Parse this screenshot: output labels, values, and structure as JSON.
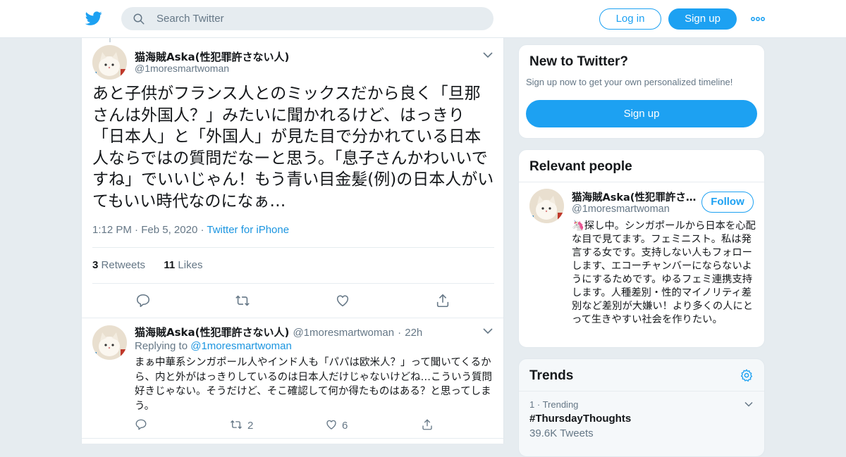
{
  "colors": {
    "brand": "#1da1f2",
    "link": "#1b95e0",
    "muted": "#657786",
    "text": "#14171a",
    "background": "#e6ecf0"
  },
  "header": {
    "logo_icon": "twitter-bird-icon",
    "search": {
      "placeholder": "Search Twitter",
      "icon": "search-icon"
    },
    "login_label": "Log in",
    "signup_label": "Sign up",
    "more_icon": "more-dots-icon"
  },
  "main_tweet": {
    "author_name": "猫海賊Aska(性犯罪許さない人)",
    "author_handle": "@1moresmartwoman",
    "text": "あと子供がフランス人とのミックスだから良く「旦那さんは外国人？」みたいに聞かれるけど、はっきり「日本人」と「外国人」が見た目で分かれている日本人ならではの質問だなーと思う。「息子さんかわいいですね」でいいじゃん！もう青い目金髪(例)の日本人がいてもいい時代なのになぁ…",
    "time": "1:12 PM",
    "date": "Feb 5, 2020",
    "source": "Twitter for iPhone",
    "retweets_count": "3",
    "retweets_label": "Retweets",
    "likes_count": "11",
    "likes_label": "Likes"
  },
  "reply_tweet": {
    "author_name": "猫海賊Aska(性犯罪許さない人)",
    "author_handle": "@1moresmartwoman",
    "age": "22h",
    "replying_label": "Replying to",
    "replying_to": "@1moresmartwoman",
    "text": "まぁ中華系シンガポール人やインド人も「パパは欧米人？」って聞いてくるから、内と外がはっきりしているのは日本人だけじゃないけどね…こういう質問好きじゃない。そうだけど、そこ確認して何か得たものはある？と思ってしまう。",
    "retweet_count": "2",
    "like_count": "6"
  },
  "sidebar": {
    "new_to_twitter": {
      "title": "New to Twitter?",
      "subtitle": "Sign up now to get your own personalized timeline!",
      "signup_label": "Sign up"
    },
    "relevant_people": {
      "title": "Relevant people",
      "name": "猫海賊Aska(性犯罪許さ…",
      "handle": "@1moresmartwoman",
      "follow_label": "Follow",
      "bio": "🦄探し中。シンガポールから日本を心配な目で見てます。フェミニスト。私は発言する女です。支持しない人もフォローします、エコーチャンバーにならないようにするためです。ゆるフェミ連携支持します。人種差別・性的マイノリティ差別など差別が大嫌い！より多くの人にとって生きやすい社会を作りたい。"
    },
    "trends": {
      "title": "Trends",
      "settings_icon": "gear-icon",
      "items": [
        {
          "rank": "1",
          "context": "Trending",
          "name": "#ThursdayThoughts",
          "count": "39.6K Tweets"
        }
      ]
    }
  }
}
